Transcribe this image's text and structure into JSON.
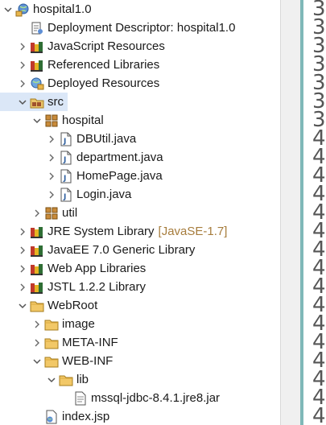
{
  "tree": {
    "items": [
      {
        "label": "hospital1.0",
        "icon": "web-project-icon",
        "expanded": true
      },
      {
        "label": "Deployment Descriptor: hospital1.0",
        "icon": "deployment-descriptor-icon"
      },
      {
        "label": "JavaScript Resources",
        "icon": "javascript-resources-icon",
        "expanded": false
      },
      {
        "label": "Referenced Libraries",
        "icon": "library-jar-icon",
        "expanded": false
      },
      {
        "label": "Deployed Resources",
        "icon": "deployed-resources-icon",
        "expanded": false
      },
      {
        "label": "src",
        "icon": "source-folder-icon",
        "expanded": true,
        "selected": true
      },
      {
        "label": "hospital",
        "icon": "package-icon",
        "expanded": true
      },
      {
        "label": "DBUtil.java",
        "icon": "java-file-icon",
        "expanded": false
      },
      {
        "label": "department.java",
        "icon": "java-file-icon",
        "expanded": false
      },
      {
        "label": "HomePage.java",
        "icon": "java-file-icon",
        "expanded": false
      },
      {
        "label": "Login.java",
        "icon": "java-file-icon",
        "expanded": false
      },
      {
        "label": "util",
        "icon": "package-icon",
        "expanded": false
      },
      {
        "label": "JRE System Library",
        "decoration": "[JavaSE-1.7]",
        "icon": "library-icon",
        "expanded": false
      },
      {
        "label": "JavaEE 7.0 Generic Library",
        "icon": "library-icon",
        "expanded": false
      },
      {
        "label": "Web App Libraries",
        "icon": "library-icon",
        "expanded": false
      },
      {
        "label": "JSTL 1.2.2 Library",
        "icon": "library-icon",
        "expanded": false
      },
      {
        "label": "WebRoot",
        "icon": "folder-icon",
        "expanded": true
      },
      {
        "label": "image",
        "icon": "folder-icon",
        "expanded": false
      },
      {
        "label": "META-INF",
        "icon": "folder-icon",
        "expanded": false
      },
      {
        "label": "WEB-INF",
        "icon": "folder-icon",
        "expanded": true
      },
      {
        "label": "lib",
        "icon": "folder-icon",
        "expanded": true
      },
      {
        "label": "mssql-jdbc-8.4.1.jre8.jar",
        "icon": "jar-file-icon"
      },
      {
        "label": "index.jsp",
        "icon": "jsp-file-icon"
      }
    ]
  },
  "editor": {
    "line_digits": [
      "3",
      "3",
      "3",
      "3",
      "3",
      "3",
      "3",
      "4",
      "4",
      "4",
      "4",
      "4",
      "4",
      "4",
      "4",
      "4",
      "4",
      "4",
      "4",
      "4",
      "4",
      "4",
      "4"
    ]
  },
  "colors": {
    "selection": "#dbe7f7",
    "decoration": "#a67c3c",
    "sash": "#7fb8b8"
  }
}
